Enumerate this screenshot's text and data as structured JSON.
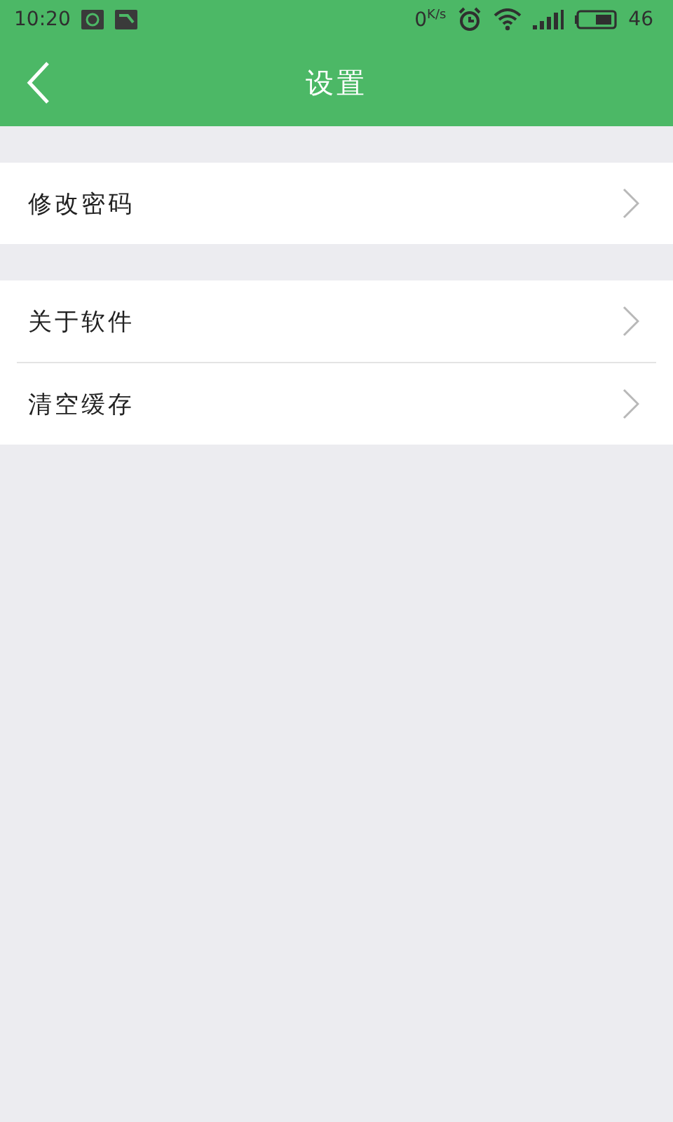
{
  "status_bar": {
    "time": "10:20",
    "speed": "0",
    "speed_unit": "K/s",
    "battery": "46"
  },
  "header": {
    "title": "设置"
  },
  "groups": [
    {
      "items": [
        {
          "label": "修改密码"
        }
      ]
    },
    {
      "items": [
        {
          "label": "关于软件"
        },
        {
          "label": "清空缓存"
        }
      ]
    }
  ]
}
